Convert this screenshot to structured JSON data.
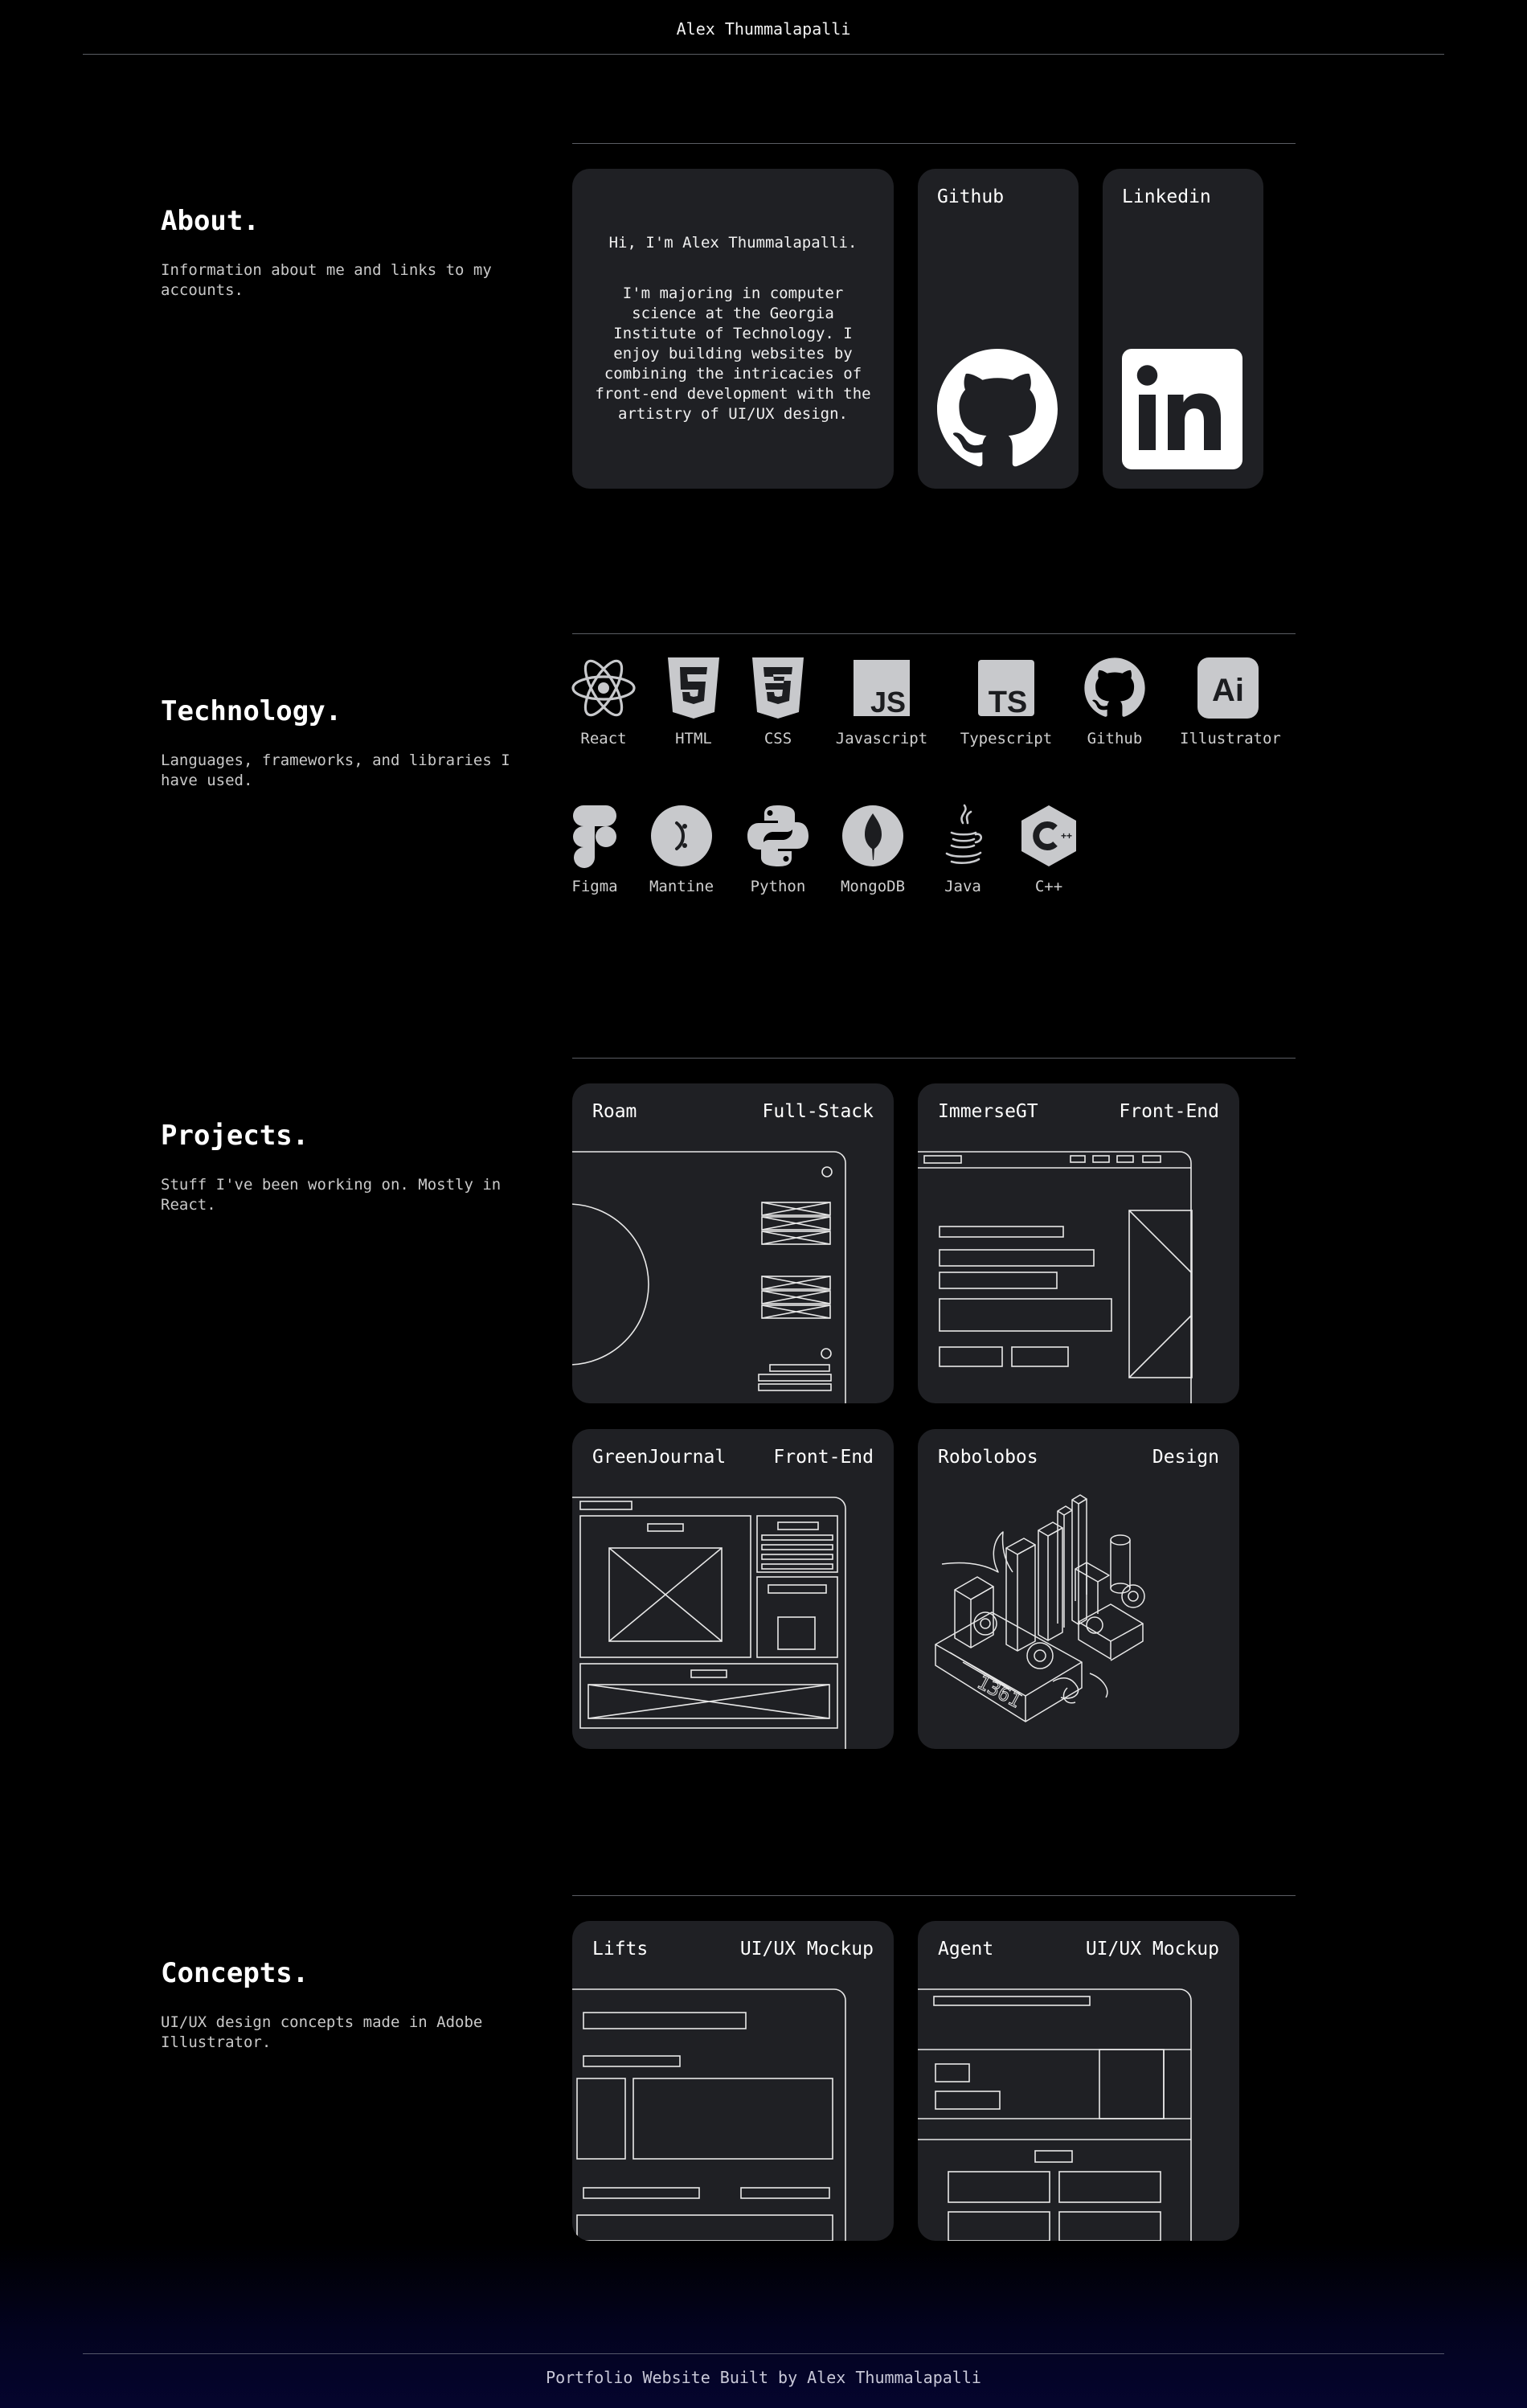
{
  "header": {
    "title": "Alex Thummalapalli"
  },
  "about": {
    "title": "About.",
    "description": "Information about me and links to my accounts.",
    "greeting": "Hi, I'm Alex Thummalapalli.",
    "bio": "I'm majoring in computer science at the Georgia Institute of Technology. I enjoy building websites by combining the intricacies of front-end development with the artistry of UI/UX design.",
    "github_label": "Github",
    "linkedin_label": "Linkedin",
    "github_icon": "github-icon",
    "linkedin_icon": "linkedin-icon"
  },
  "technology": {
    "title": "Technology.",
    "description": "Languages, frameworks, and libraries I have used.",
    "row1": [
      {
        "label": "React",
        "icon": "react-icon"
      },
      {
        "label": "HTML",
        "icon": "html5-icon"
      },
      {
        "label": "CSS",
        "icon": "css3-icon"
      },
      {
        "label": "Javascript",
        "icon": "javascript-icon"
      },
      {
        "label": "Typescript",
        "icon": "typescript-icon"
      },
      {
        "label": "Github",
        "icon": "github-icon"
      },
      {
        "label": "Illustrator",
        "icon": "illustrator-icon"
      }
    ],
    "row2": [
      {
        "label": "Figma",
        "icon": "figma-icon"
      },
      {
        "label": "Mantine",
        "icon": "mantine-icon"
      },
      {
        "label": "Python",
        "icon": "python-icon"
      },
      {
        "label": "MongoDB",
        "icon": "mongodb-icon"
      },
      {
        "label": "Java",
        "icon": "java-icon"
      },
      {
        "label": "C++",
        "icon": "cplusplus-icon"
      }
    ]
  },
  "projects": {
    "title": "Projects.",
    "description": "Stuff I've been working on. Mostly in React.",
    "items": [
      {
        "name": "Roam",
        "tag": "Full-Stack"
      },
      {
        "name": "ImmerseGT",
        "tag": "Front-End"
      },
      {
        "name": "GreenJournal",
        "tag": "Front-End"
      },
      {
        "name": "Robolobos",
        "tag": "Design"
      }
    ]
  },
  "concepts": {
    "title": "Concepts.",
    "description": "UI/UX design concepts made in Adobe Illustrator.",
    "items": [
      {
        "name": "Lifts",
        "tag": "UI/UX Mockup"
      },
      {
        "name": "Agent",
        "tag": "UI/UX Mockup"
      }
    ]
  },
  "footer": {
    "text": "Portfolio Website Built by Alex Thummalapalli"
  },
  "colors": {
    "background": "#000000",
    "card": "#1f2024",
    "text": "#ffffff",
    "icon": "#c8c9cc",
    "divider": "#5a5d63"
  }
}
